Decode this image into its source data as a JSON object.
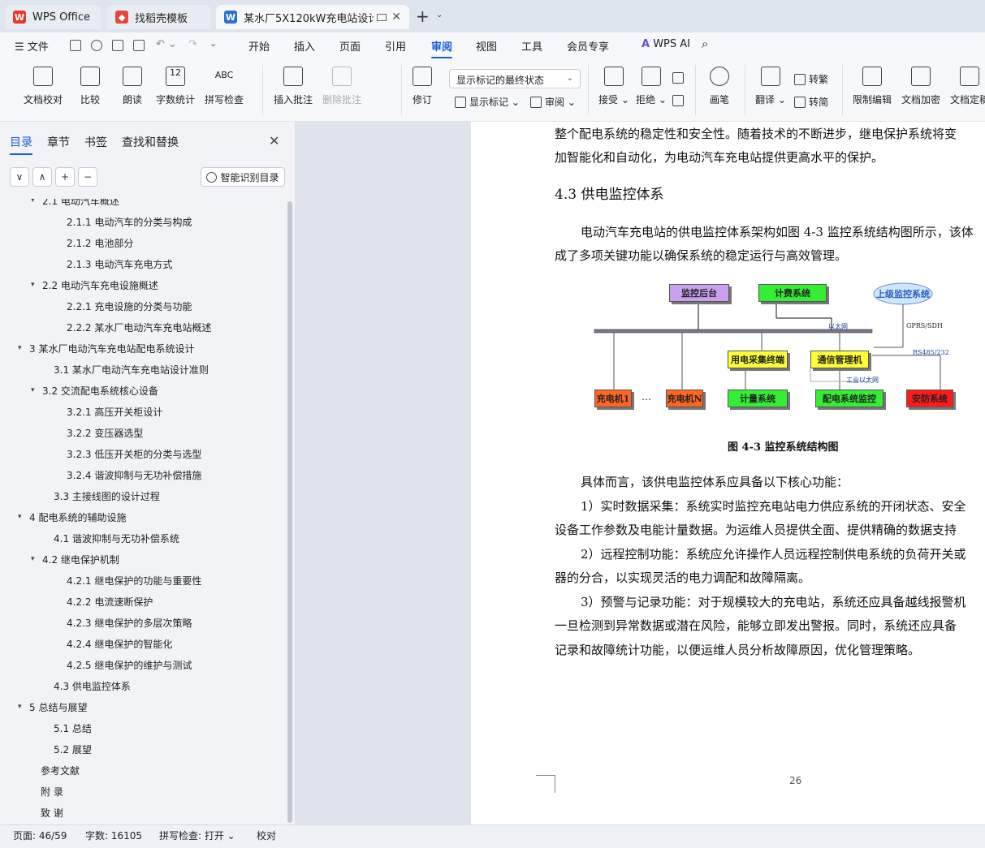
{
  "tabs": [
    {
      "label": "WPS Office",
      "active": false
    },
    {
      "label": "找稻壳模板",
      "active": false
    },
    {
      "label": "某水厂5X120kW充电站设计",
      "active": true
    }
  ],
  "menu": {
    "file": "文件",
    "items": [
      "开始",
      "插入",
      "页面",
      "引用",
      "审阅",
      "视图",
      "工具",
      "会员专享"
    ],
    "active": "审阅",
    "wps_ai": "WPS AI"
  },
  "ribbon": {
    "doc_check": "文档校对",
    "compare": "比较",
    "read_aloud": "朗读",
    "word_count": "字数统计",
    "spell_check": "拼写检查",
    "word_count_icon": "12",
    "spell_icon": "ABC",
    "insert_comment": "插入批注",
    "delete_comment": "删除批注",
    "track_changes": "修订",
    "display_mode": "显示标记的最终状态",
    "show_markup": "显示标记",
    "review": "审阅",
    "accept": "接受",
    "reject": "拒绝",
    "pen": "画笔",
    "translate": "翻译",
    "to_traditional": "转繁",
    "to_simplified": "转简",
    "restrict_edit": "限制编辑",
    "encrypt": "文档加密",
    "doc_final": "文档定稿"
  },
  "nav": {
    "tabs": [
      "目录",
      "章节",
      "书签",
      "查找和替换"
    ],
    "smart_toc": "智能识别目录",
    "buttons": [
      "∨",
      "∧",
      "+",
      "−"
    ]
  },
  "toc": [
    {
      "text": "2.1  电动汽车概述",
      "level": 2,
      "toggle": "▾"
    },
    {
      "text": "2.1.1  电动汽车的分类与构成",
      "level": 3,
      "toggle": ""
    },
    {
      "text": "2.1.2  电池部分",
      "level": 3,
      "toggle": ""
    },
    {
      "text": "2.1.3  电动汽车充电方式",
      "level": 3,
      "toggle": ""
    },
    {
      "text": "2.2  电动汽车充电设施概述",
      "level": 2,
      "toggle": "▾"
    },
    {
      "text": "2.2.1  充电设施的分类与功能",
      "level": 3,
      "toggle": ""
    },
    {
      "text": "2.2.2  某水厂电动汽车充电站概述",
      "level": 3,
      "toggle": ""
    },
    {
      "text": "3  某水厂电动汽车充电站配电系统设计",
      "level": 1,
      "toggle": "▾"
    },
    {
      "text": "3.1  某水厂电动汽车充电站设计准则",
      "level": 2,
      "toggle": ""
    },
    {
      "text": "3.2  交流配电系统核心设备",
      "level": 2,
      "toggle": "▾"
    },
    {
      "text": "3.2.1  高压开关柜设计",
      "level": 3,
      "toggle": ""
    },
    {
      "text": "3.2.2  变压器选型",
      "level": 3,
      "toggle": ""
    },
    {
      "text": "3.2.3  低压开关柜的分类与选型",
      "level": 3,
      "toggle": ""
    },
    {
      "text": "3.2.4  谐波抑制与无功补偿措施",
      "level": 3,
      "toggle": ""
    },
    {
      "text": "3.3  主接线图的设计过程",
      "level": 2,
      "toggle": ""
    },
    {
      "text": "4  配电系统的辅助设施",
      "level": 1,
      "toggle": "▾"
    },
    {
      "text": "4.1  谐波抑制与无功补偿系统",
      "level": 2,
      "toggle": ""
    },
    {
      "text": "4.2  继电保护机制",
      "level": 2,
      "toggle": "▾"
    },
    {
      "text": "4.2.1  继电保护的功能与重要性",
      "level": 3,
      "toggle": ""
    },
    {
      "text": "4.2.2  电流速断保护",
      "level": 3,
      "toggle": ""
    },
    {
      "text": "4.2.3  继电保护的多层次策略",
      "level": 3,
      "toggle": ""
    },
    {
      "text": "4.2.4  继电保护的智能化",
      "level": 3,
      "toggle": ""
    },
    {
      "text": "4.2.5  继电保护的维护与测试",
      "level": 3,
      "toggle": ""
    },
    {
      "text": "4.3  供电监控体系",
      "level": 2,
      "toggle": ""
    },
    {
      "text": "5  总结与展望",
      "level": 1,
      "toggle": "▾"
    },
    {
      "text": "5.1  总结",
      "level": 2,
      "toggle": ""
    },
    {
      "text": "5.2  展望",
      "level": 2,
      "toggle": ""
    },
    {
      "text": "参考文献",
      "level": 1,
      "toggle": ""
    },
    {
      "text": "附    录",
      "level": 1,
      "toggle": ""
    },
    {
      "text": "致    谢",
      "level": 1,
      "toggle": ""
    }
  ],
  "doc": {
    "lines_top": [
      "整个配电系统的稳定性和安全性。随着技术的不断进步，继电保护系统将变",
      "加智能化和自动化，为电动汽车充电站提供更高水平的保护。"
    ],
    "heading": "4.3  供电监控体系",
    "intro": [
      "电动汽车充电站的供电监控体系架构如图 4-3 监控系统结构图所示，该体",
      "成了多项关键功能以确保系统的稳定运行与高效管理。"
    ],
    "caption": "图 4-3  监控系统结构图",
    "body": [
      "具体而言，该供电监控体系应具备以下核心功能：",
      "1）实时数据采集：系统实时监控充电站电力供应系统的开闭状态、安全",
      "设备工作参数及电能计量数据。为运维人员提供全面、提供精确的数据支持",
      "2）远程控制功能：系统应允许操作人员远程控制供电系统的负荷开关或",
      "器的分合，以实现灵活的电力调配和故障隔离。",
      "3）预警与记录功能：对于规模较大的充电站，系统还应具备越线报警机",
      "一旦检测到异常数据或潜在风险，能够立即发出警报。同时，系统还应具备",
      "记录和故障统计功能，以便运维人员分析故障原因，优化管理策略。"
    ],
    "page_number": "26"
  },
  "diagram": {
    "monitor_backend": "监控后台",
    "billing": "计费系统",
    "upper_monitor": "上级监控系统",
    "ethernet": "以太网",
    "gprs": "GPRS/SDH",
    "rs485": "RS485/232",
    "industrial_ethernet": "工业以太网",
    "power_terminal": "用电采集终端",
    "comm_manager": "通信管理机",
    "charger1": "充电机1",
    "ellipsis": "…",
    "chargerN": "充电机N",
    "metering": "计量系统",
    "distribution_monitor": "配电系统监控",
    "security": "安防系统",
    "colors": {
      "purple": "#c9a0f0",
      "green": "#33ee33",
      "yellow": "#ffff33",
      "orange": "#ff6622",
      "red": "#ff1a1a",
      "cloud": "#cfe6ff"
    }
  },
  "status": {
    "page": "页面: 46/59",
    "words": "字数: 16105",
    "spell": "拼写检查: 打开",
    "proof": "校对"
  }
}
